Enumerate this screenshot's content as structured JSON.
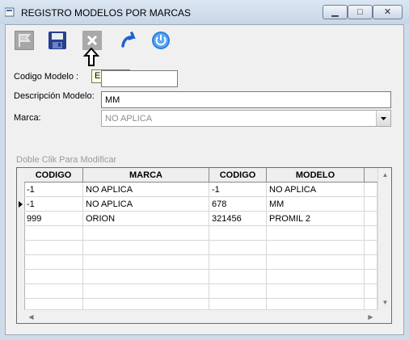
{
  "window": {
    "title": "REGISTRO MODELOS POR MARCAS",
    "min_symbol": "▁",
    "max_symbol": "□",
    "close_symbol": "✕"
  },
  "toolbar": {
    "new": "new-icon",
    "save": "save-icon",
    "delete": "delete-icon",
    "undo": "undo-icon",
    "exit": "power-icon",
    "tooltip": "Eliminar"
  },
  "form": {
    "code_label": "Codigo Modelo :",
    "code_value": "",
    "desc_label": "Descripción Modelo:",
    "desc_value": "MM",
    "brand_label": "Marca:",
    "brand_value": "NO APLICA"
  },
  "grid": {
    "hint": "Doble Clik Para Modificar",
    "columns": [
      "CODIGO",
      "MARCA",
      "CODIGO",
      "MODELO"
    ],
    "rows": [
      [
        "-1",
        "NO APLICA",
        "-1",
        "NO APLICA"
      ],
      [
        "-1",
        "NO APLICA",
        "678",
        "MM"
      ],
      [
        "999",
        "ORION",
        "321456",
        "PROMIL 2"
      ]
    ],
    "current_row": 2
  },
  "colors": {
    "title_bg": "#dbe6f2",
    "client_bg": "#f0f0f0",
    "accent_blue": "#1f5fd0"
  }
}
